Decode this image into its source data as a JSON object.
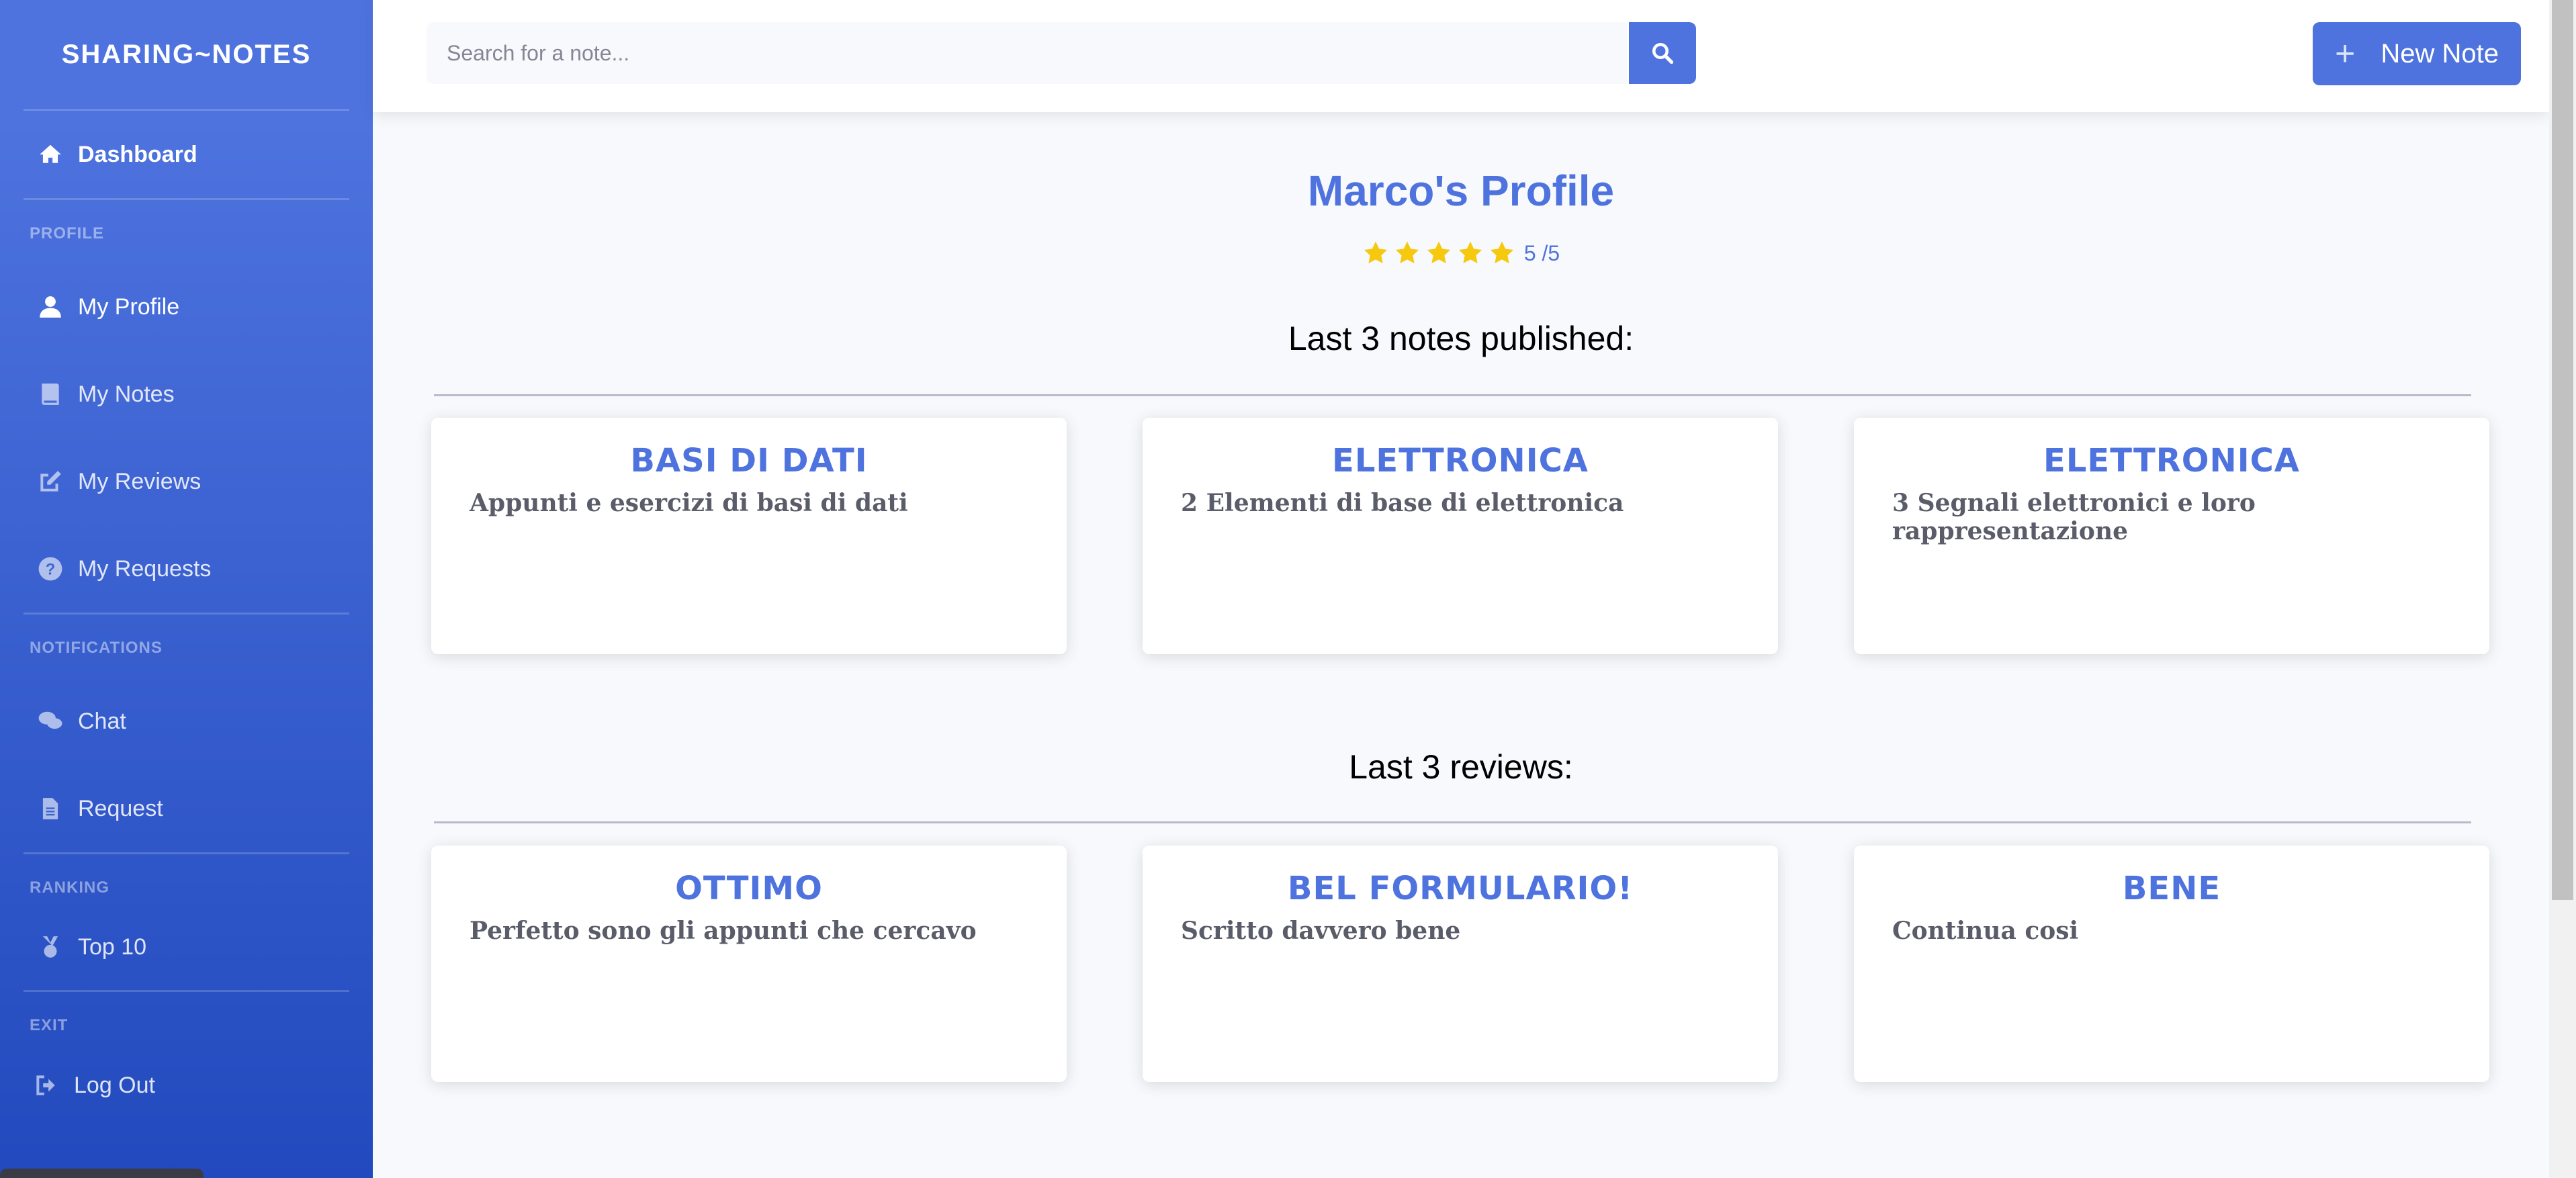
{
  "brand": "SHARING~NOTES",
  "sidebar": {
    "dashboard": "Dashboard",
    "sections": {
      "profile": "PROFILE",
      "notifications": "NOTIFICATIONS",
      "ranking": "RANKING",
      "exit": "EXIT"
    },
    "items": {
      "my_profile": "My Profile",
      "my_notes": "My Notes",
      "my_reviews": "My Reviews",
      "my_requests": "My Requests",
      "chat": "Chat",
      "request": "Request",
      "top10": "Top 10",
      "logout": "Log Out"
    }
  },
  "topbar": {
    "search_placeholder": "Search for a note...",
    "new_note": "New Note"
  },
  "profile": {
    "title": "Marco's Profile",
    "rating_value": 5,
    "rating_text": "5 /5"
  },
  "notes": {
    "heading": "Last 3 notes published:",
    "cards": [
      {
        "title": "BASI DI DATI",
        "body": "Appunti e esercizi di basi di dati"
      },
      {
        "title": "ELETTRONICA",
        "body": "2 Elementi di base di elettronica"
      },
      {
        "title": "ELETTRONICA",
        "body": "3 Segnali elettronici e loro rappresentazione"
      }
    ]
  },
  "reviews": {
    "heading": "Last 3 reviews:",
    "cards": [
      {
        "title": "OTTIMO",
        "body": "Perfetto sono gli appunti che cercavo"
      },
      {
        "title": "BEL FORMULARIO!",
        "body": "Scritto davvero bene"
      },
      {
        "title": "BENE",
        "body": "Continua cosi"
      }
    ]
  },
  "colors": {
    "primary": "#4e73df",
    "star": "#f6c90e",
    "text_dark": "#5a5c69"
  },
  "icons": {
    "dashboard": "home-icon",
    "my_profile": "user-icon",
    "my_notes": "book-icon",
    "my_reviews": "edit-icon",
    "my_requests": "question-circle-icon",
    "chat": "comments-icon",
    "request": "file-icon",
    "top10": "medal-icon",
    "logout": "sign-out-icon",
    "search": "search-icon",
    "new_note": "plus-icon",
    "rating": "star-icon"
  }
}
